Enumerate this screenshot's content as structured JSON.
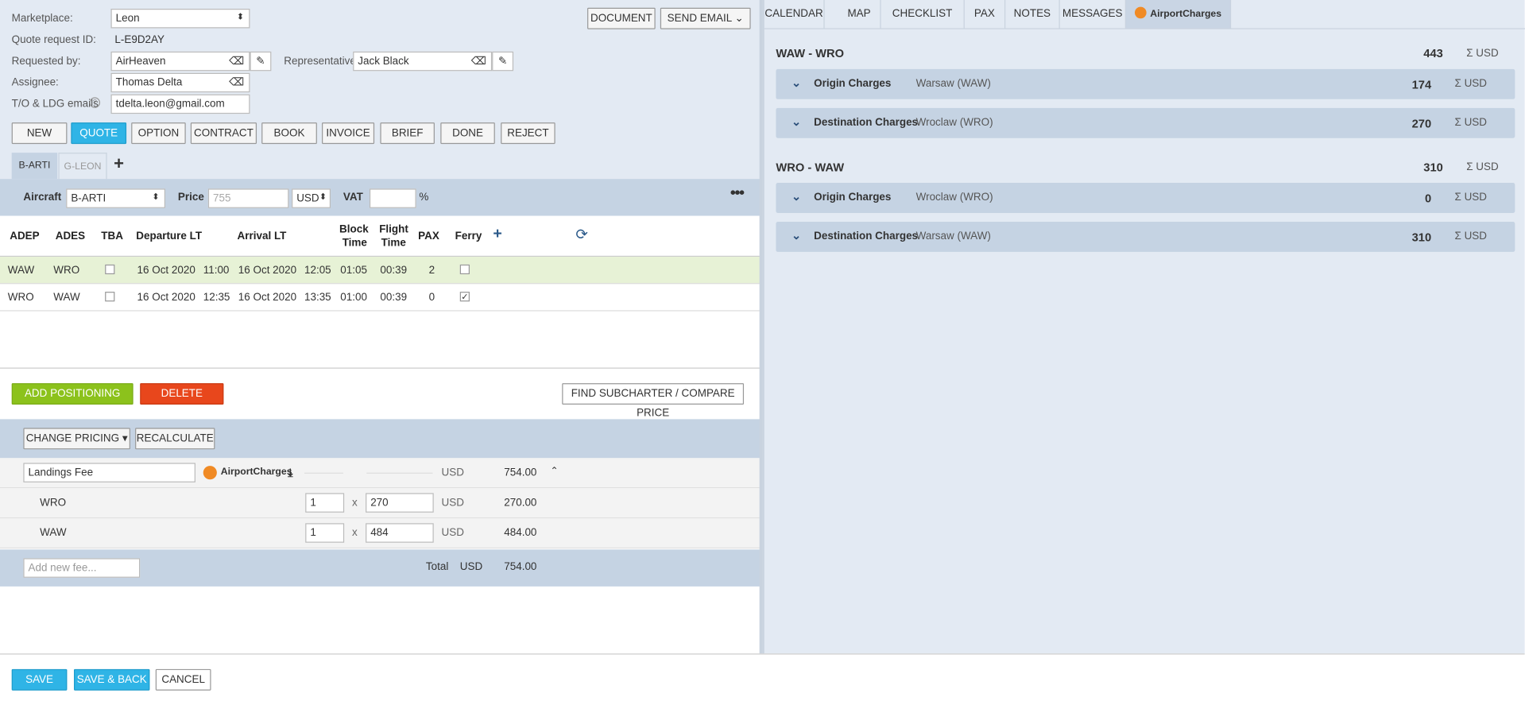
{
  "form": {
    "marketplace_label": "Marketplace:",
    "marketplace_value": "Leon",
    "quote_id_label": "Quote request ID:",
    "quote_id_value": "L-E9D2AY",
    "requested_label": "Requested by:",
    "requested_value": "AirHeaven",
    "representative_label": "Representative:",
    "representative_value": "Jack Black",
    "assignee_label": "Assignee:",
    "assignee_value": "Thomas Delta",
    "emails_label": "T/O & LDG emails",
    "emails_value": "tdelta.leon@gmail.com",
    "document_btn": "DOCUMENT",
    "send_email_btn": "SEND EMAIL"
  },
  "status_buttons": [
    "NEW",
    "QUOTE",
    "OPTION",
    "CONTRACT",
    "BOOK",
    "INVOICE",
    "BRIEF",
    "DONE",
    "REJECT"
  ],
  "aircraft_tabs": [
    "B-ARTI",
    "G-LEON"
  ],
  "aircraft_bar": {
    "aircraft_label": "Aircraft",
    "aircraft_value": "B-ARTI",
    "price_label": "Price",
    "price_placeholder": "755",
    "currency": "USD",
    "vat_label": "VAT",
    "pct": "%"
  },
  "legs_header": {
    "adep": "ADEP",
    "ades": "ADES",
    "tba": "TBA",
    "dep": "Departure LT",
    "arr": "Arrival LT",
    "block1": "Block",
    "block2": "Time",
    "flight1": "Flight",
    "flight2": "Time",
    "pax": "PAX",
    "ferry": "Ferry"
  },
  "legs": [
    {
      "adep": "WAW",
      "ades": "WRO",
      "dep_date": "16 Oct 2020",
      "dep_time": "11:00",
      "arr_date": "16 Oct 2020",
      "arr_time": "12:05",
      "block": "01:05",
      "flight": "00:39",
      "pax": "2",
      "ferry": false
    },
    {
      "adep": "WRO",
      "ades": "WAW",
      "dep_date": "16 Oct 2020",
      "dep_time": "12:35",
      "arr_date": "16 Oct 2020",
      "arr_time": "13:35",
      "block": "01:00",
      "flight": "00:39",
      "pax": "0",
      "ferry": true
    }
  ],
  "actions": {
    "add_positioning": "ADD POSITIONING LEGS",
    "delete_quote": "DELETE QUOTE",
    "find_subcharter": "FIND SUBCHARTER / COMPARE PRICE"
  },
  "pricing": {
    "change_pricing": "CHANGE PRICING",
    "recalculate": "RECALCULATE",
    "fee_name": "Landings Fee",
    "provider": "AirportCharges",
    "fee_currency": "USD",
    "fee_amount": "754.00",
    "sub_rows": [
      {
        "name": "WRO",
        "qty": "1",
        "x": "x",
        "price": "270",
        "currency": "USD",
        "amount": "270.00"
      },
      {
        "name": "WAW",
        "qty": "1",
        "x": "x",
        "price": "484",
        "currency": "USD",
        "amount": "484.00"
      }
    ],
    "new_fee_placeholder": "Add new fee...",
    "total_label": "Total",
    "total_currency": "USD",
    "total_amount": "754.00"
  },
  "footer": {
    "save": "SAVE",
    "save_back": "SAVE & BACK",
    "cancel": "CANCEL"
  },
  "right_tabs": [
    "CALENDAR",
    "MAP",
    "CHECKLIST",
    "PAX",
    "NOTES",
    "MESSAGES",
    "AirportCharges"
  ],
  "charges": [
    {
      "route": "WAW - WRO",
      "total": "443",
      "sum": "Σ USD",
      "items": [
        {
          "title": "Origin Charges",
          "airport": "Warsaw (WAW)",
          "amount": "174",
          "sum": "Σ USD"
        },
        {
          "title": "Destination Charges",
          "airport": "Wroclaw (WRO)",
          "amount": "270",
          "sum": "Σ USD"
        }
      ]
    },
    {
      "route": "WRO - WAW",
      "total": "310",
      "sum": "Σ USD",
      "items": [
        {
          "title": "Origin Charges",
          "airport": "Wroclaw (WRO)",
          "amount": "0",
          "sum": "Σ USD"
        },
        {
          "title": "Destination Charges",
          "airport": "Warsaw (WAW)",
          "amount": "310",
          "sum": "Σ USD"
        }
      ]
    }
  ],
  "colors": {
    "accent_blue": "#2fb4e6",
    "green": "#8cc21c",
    "red": "#e8471c",
    "panel": "#c5d3e3",
    "orange_logo": "#f08a24"
  }
}
